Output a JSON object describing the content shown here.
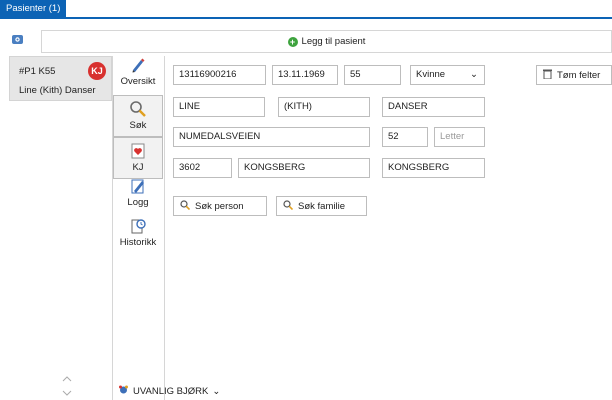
{
  "tab": {
    "label": "Pasienter (1)"
  },
  "toolbar": {
    "add_patient_label": "Legg til pasient"
  },
  "patient": {
    "id": "#P1 K55",
    "name": "Line (Kith) Danser",
    "badge": "KJ"
  },
  "nav": [
    {
      "label": "Oversikt",
      "icon": "pencil-icon"
    },
    {
      "label": "Søk",
      "icon": "magnifier-icon"
    },
    {
      "label": "KJ",
      "icon": "heart-card-icon"
    },
    {
      "label": "Logg",
      "icon": "log-pen-icon"
    },
    {
      "label": "Historikk",
      "icon": "history-icon"
    }
  ],
  "form": {
    "personnr": "13116900216",
    "birthdate": "13.11.1969",
    "age": "55",
    "gender": "Kvinne",
    "first_name": "LINE",
    "middle_name": "(KITH)",
    "last_name": "DANSER",
    "street": "NUMEDALSVEIEN",
    "house_no": "52",
    "letter_placeholder": "Letter",
    "postcode": "3602",
    "city": "KONGSBERG",
    "municipality": "KONGSBERG"
  },
  "buttons": {
    "clear": "Tøm felter",
    "search_person": "Søk person",
    "search_family": "Søk familie"
  },
  "footer": {
    "label": "UVANLIG BJØRK"
  }
}
